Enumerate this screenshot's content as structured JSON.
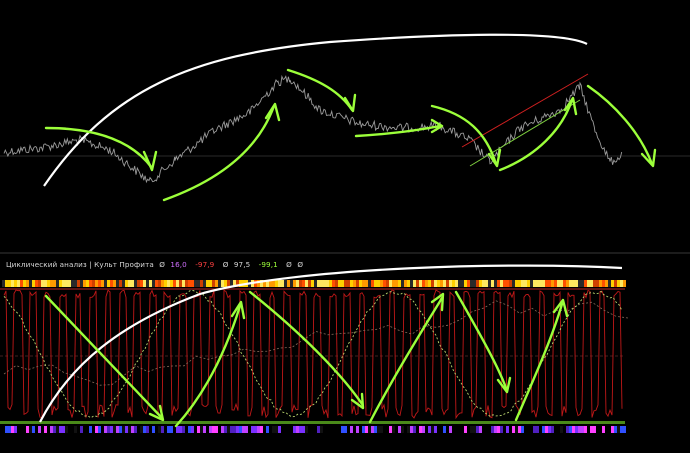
{
  "indicator_legend": {
    "title": "Циклический анализ | Культ Профита",
    "values": [
      {
        "prefix": "Ø",
        "text": "16,0",
        "color": "#d070ff"
      },
      {
        "prefix": "",
        "text": "-97,9",
        "color": "#ff4040"
      },
      {
        "prefix": "Ø",
        "text": "97,5",
        "color": "#e8e8e8"
      },
      {
        "prefix": "",
        "text": "-99,1",
        "color": "#9cff3a"
      },
      {
        "prefix": "Ø",
        "text": "",
        "color": "#e8e8e8"
      },
      {
        "prefix": "Ø",
        "text": "",
        "color": "#e8e8e8"
      }
    ]
  },
  "colors": {
    "background": "#000000",
    "price_line": "#9a9a9a",
    "annotation_green": "#9cff3a",
    "annotation_white": "#ffffff",
    "oscillator_red": "#c01818",
    "band_red": "#7a1a1a",
    "dashed_level": "#6a4a3a",
    "bottom_bar": "#4a8a1a"
  },
  "icons": {
    "annotation_arrow": "arrowhead"
  }
}
